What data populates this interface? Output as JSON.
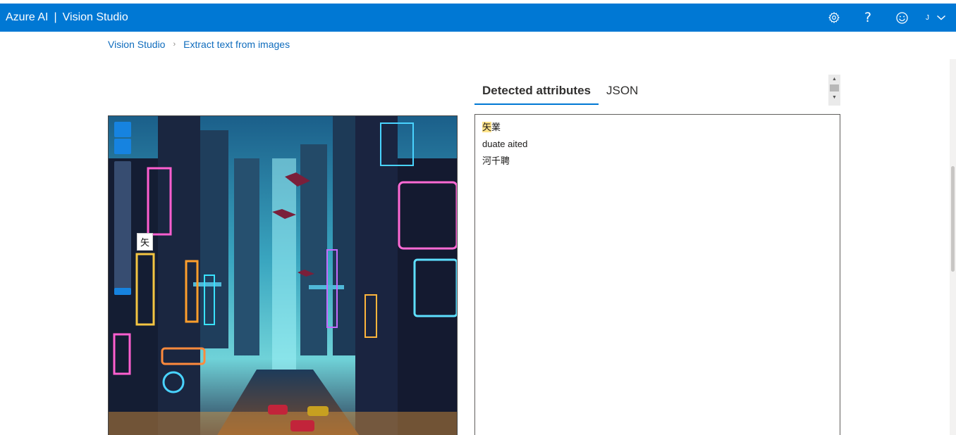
{
  "header": {
    "brand_left": "Azure AI",
    "brand_separator": "|",
    "brand_right": "Vision Studio",
    "account_initial": "J",
    "help_label": "?",
    "icons": {
      "settings": "gear-icon",
      "help": "question-icon",
      "feedback": "smiley-icon",
      "account_menu": "chevron-down-icon"
    },
    "accent_color": "#0078d4"
  },
  "breadcrumb": {
    "items": [
      "Vision Studio",
      "Extract text from images"
    ],
    "separator": "›"
  },
  "image": {
    "tooltip": "矢"
  },
  "tabs": [
    {
      "label": "Detected attributes",
      "active": true
    },
    {
      "label": "JSON",
      "active": false
    }
  ],
  "results": {
    "lines": [
      {
        "highlight": "矢",
        "rest": "業"
      },
      {
        "highlight": "",
        "rest": "duate aited"
      },
      {
        "highlight": "",
        "rest": "河千聘"
      }
    ]
  }
}
